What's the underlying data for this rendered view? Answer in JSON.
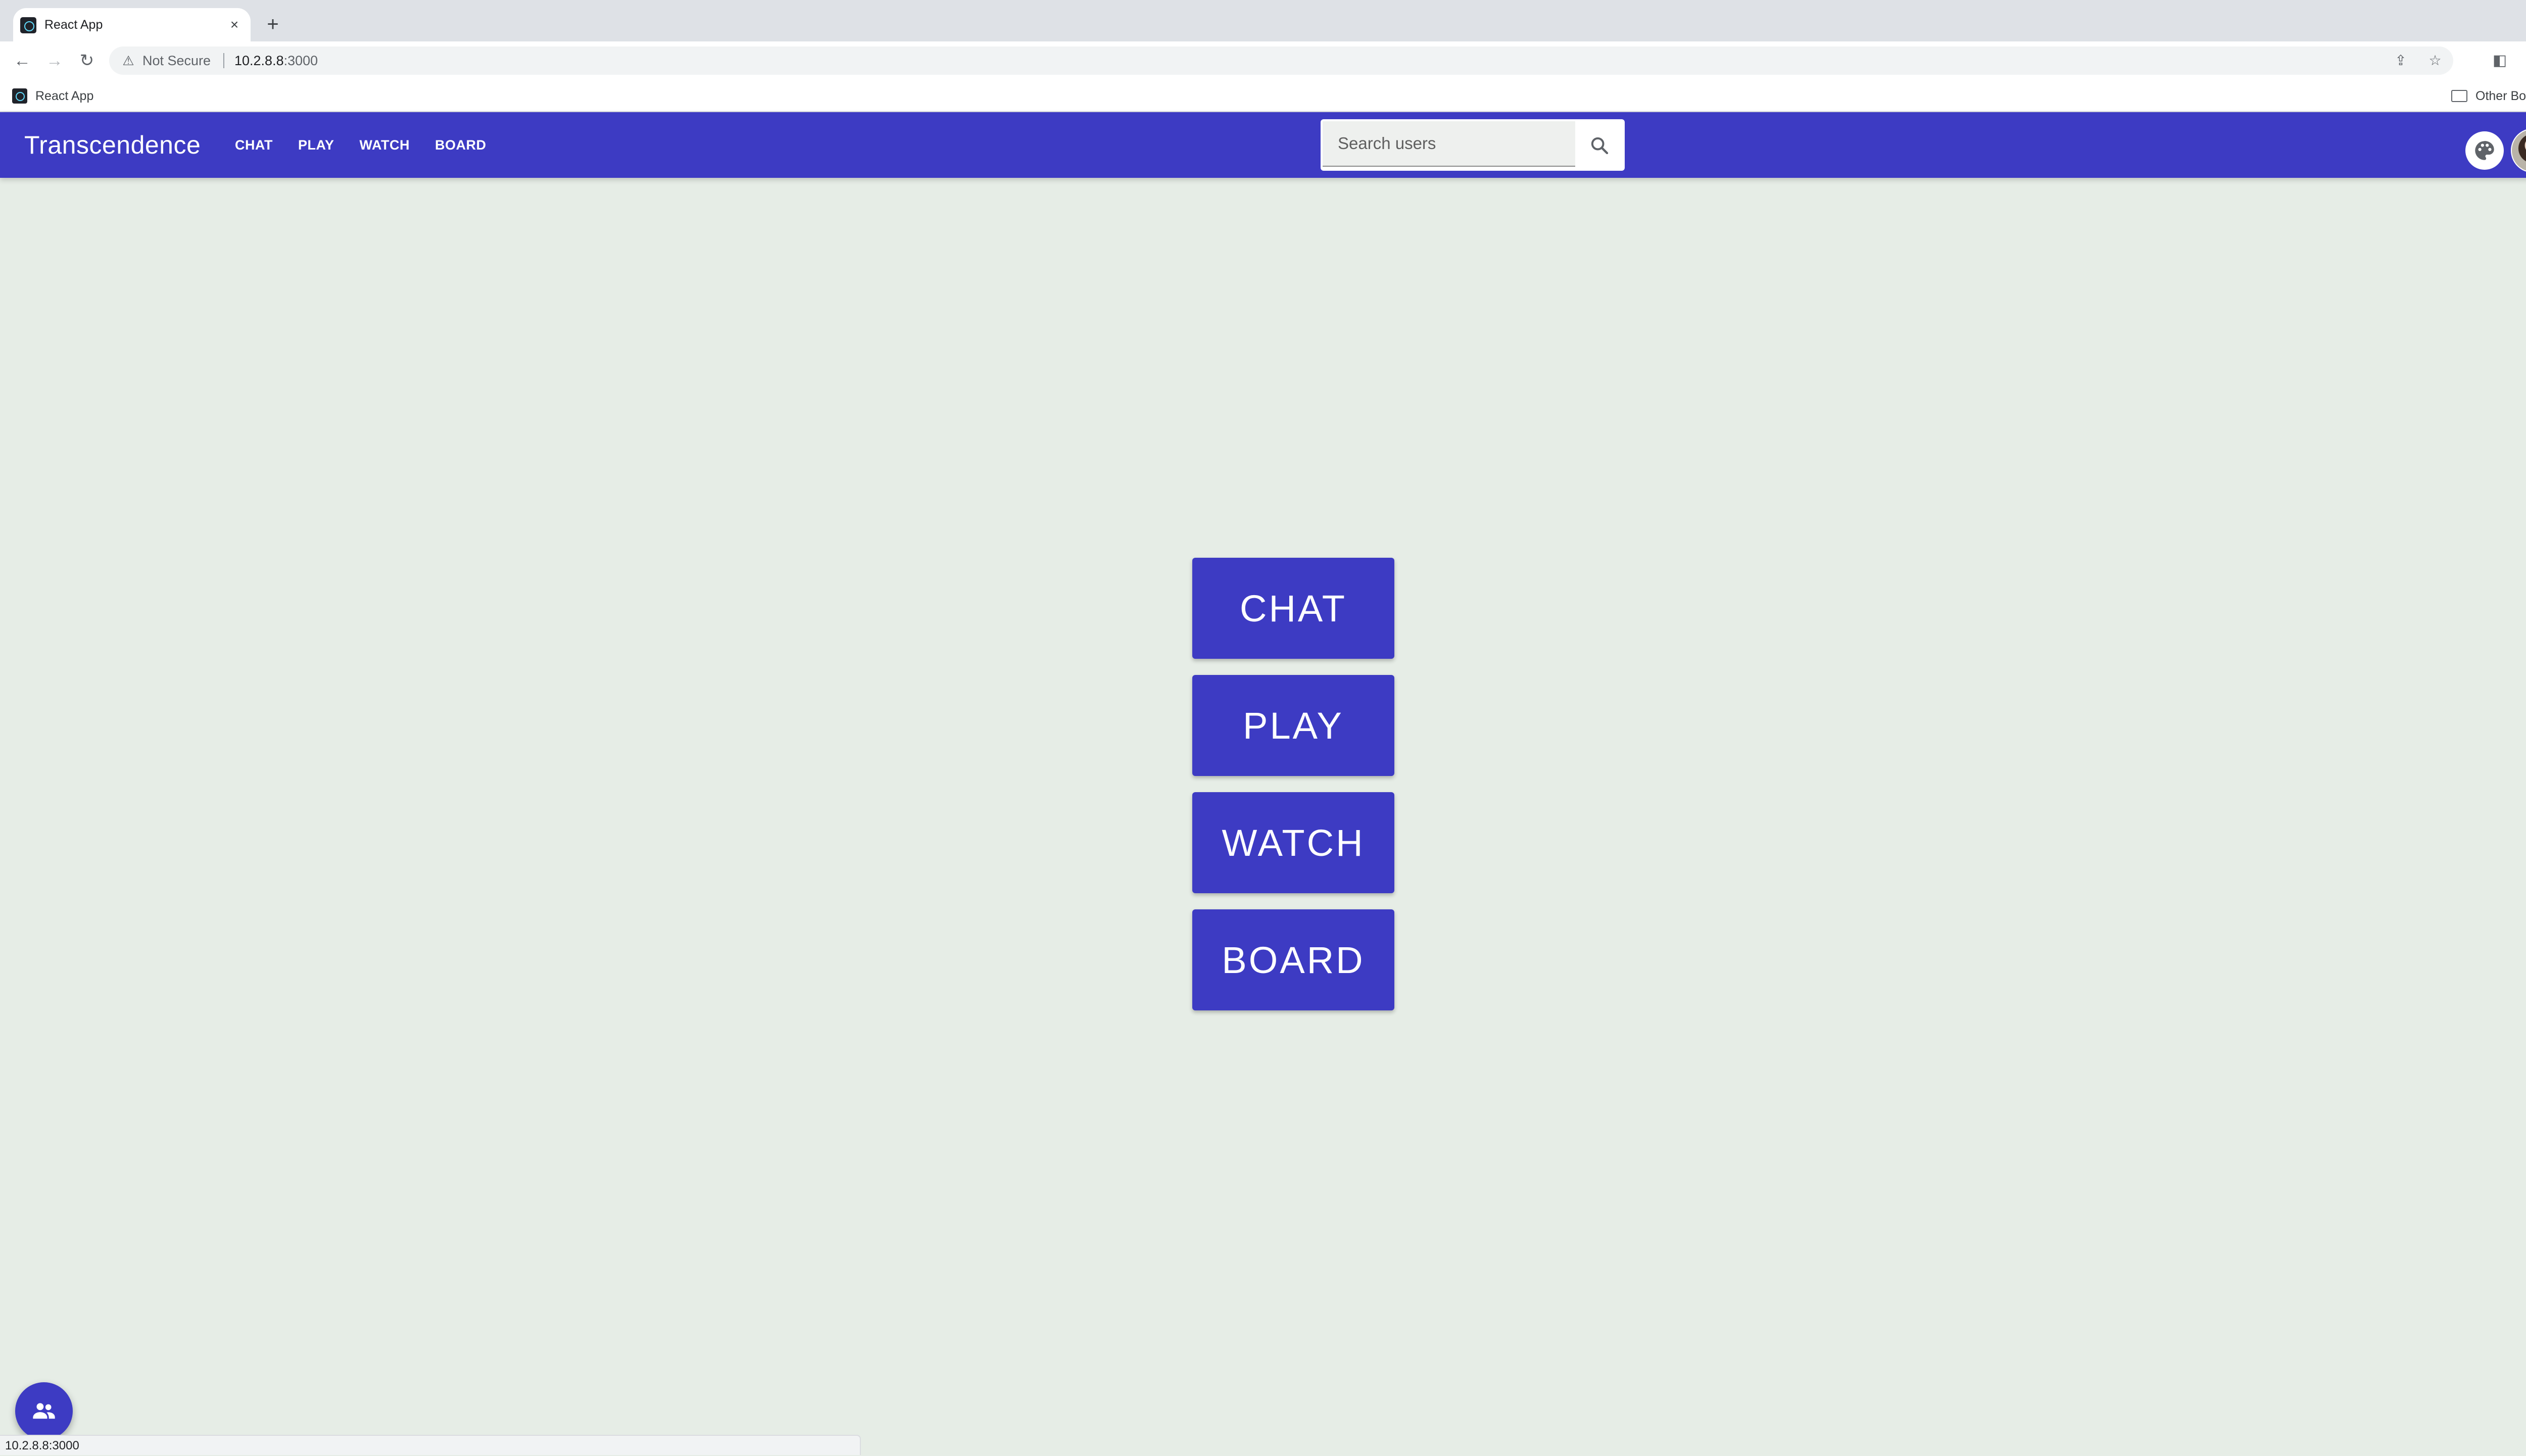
{
  "browser": {
    "tab_title": "React App",
    "close_glyph": "×",
    "new_tab_glyph": "+",
    "tabs_dropdown_glyph": "⌄",
    "back_glyph": "←",
    "forward_glyph": "→",
    "reload_glyph": "↻",
    "security_label": "Not Secure",
    "url_host": "10.2.8.8",
    "url_port": ":3000",
    "bookmark": "React App",
    "other_bookmarks": "Other Bookmarks",
    "status_url": "10.2.8.8:3000"
  },
  "app": {
    "brand": "Transcendence",
    "nav": [
      "CHAT",
      "PLAY",
      "WATCH",
      "BOARD"
    ],
    "search_placeholder": "Search users",
    "accent_color": "#3d3bc3",
    "background_color": "#e6ede6"
  },
  "main": {
    "buttons": [
      "CHAT",
      "PLAY",
      "WATCH",
      "BOARD"
    ]
  },
  "icons": {
    "search": "search-icon",
    "theme": "palette-icon",
    "friends": "people-icon"
  }
}
